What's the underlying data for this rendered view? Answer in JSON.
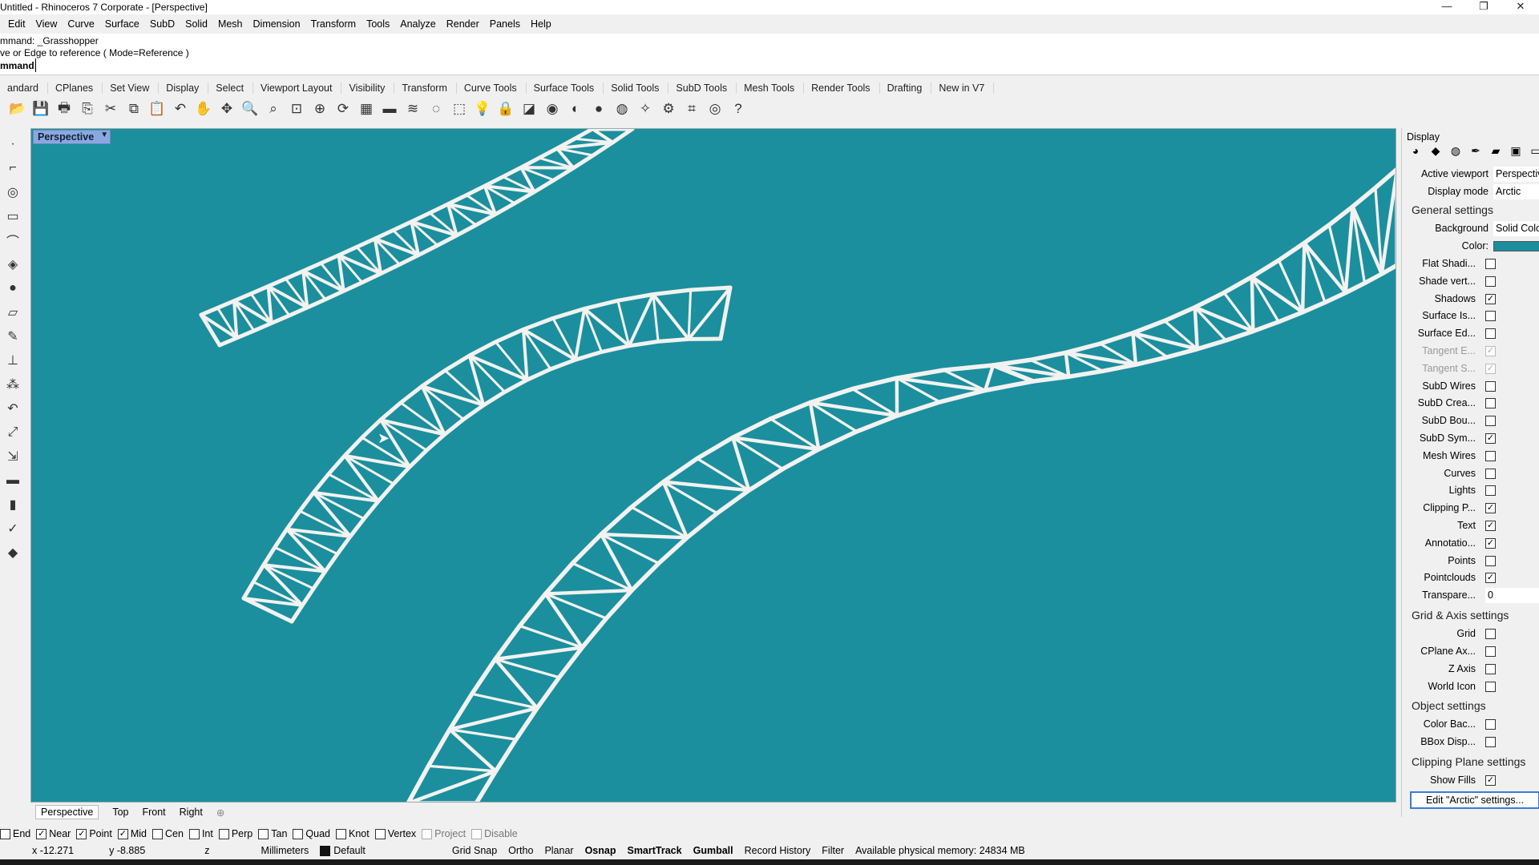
{
  "window": {
    "title": "Untitled - Rhinoceros 7 Corporate - [Perspective]",
    "minimize": "—",
    "maximize": "❐",
    "close": "✕"
  },
  "menu": [
    "Edit",
    "View",
    "Curve",
    "Surface",
    "SubD",
    "Solid",
    "Mesh",
    "Dimension",
    "Transform",
    "Tools",
    "Analyze",
    "Render",
    "Panels",
    "Help"
  ],
  "command": {
    "history1": "mmand: _Grasshopper",
    "history2": "ve or Edge to reference ( Mode=Reference )",
    "prompt": "mmand:",
    "value": ""
  },
  "toolbar_tabs": [
    "andard",
    "CPlanes",
    "Set View",
    "Display",
    "Select",
    "Viewport Layout",
    "Visibility",
    "Transform",
    "Curve Tools",
    "Surface Tools",
    "Solid Tools",
    "SubD Tools",
    "Mesh Tools",
    "Render Tools",
    "Drafting",
    "New in V7"
  ],
  "toolbar_icons": [
    "open-icon",
    "save-icon",
    "print-icon",
    "import-icon",
    "cut-icon",
    "copy-icon",
    "paste-icon",
    "undo-icon",
    "pan-icon",
    "rotate-view-icon",
    "zoom-icon",
    "zoom-window-icon",
    "zoom-extents-icon",
    "zoom-selected-icon",
    "rotate-icon",
    "grid-icon",
    "properties-icon",
    "layer-icon",
    "point-icon",
    "select-icon",
    "light-icon",
    "lock-icon",
    "render-icon",
    "color-icon",
    "material-icon",
    "shaded-icon",
    "rendered-icon",
    "gumball-icon",
    "options-icon",
    "snap-icon",
    "globe-icon",
    "help-icon"
  ],
  "viewport": {
    "name": "Perspective",
    "background": "#1b8f9d"
  },
  "viewport_tabs": [
    "Perspective",
    "Top",
    "Front",
    "Right"
  ],
  "viewport_add": "⊕",
  "osnaps": [
    {
      "label": "End",
      "checked": false,
      "dim": false
    },
    {
      "label": "Near",
      "checked": true,
      "dim": false
    },
    {
      "label": "Point",
      "checked": true,
      "dim": false
    },
    {
      "label": "Mid",
      "checked": true,
      "dim": false
    },
    {
      "label": "Cen",
      "checked": false,
      "dim": false
    },
    {
      "label": "Int",
      "checked": false,
      "dim": false
    },
    {
      "label": "Perp",
      "checked": false,
      "dim": false
    },
    {
      "label": "Tan",
      "checked": false,
      "dim": false
    },
    {
      "label": "Quad",
      "checked": false,
      "dim": false
    },
    {
      "label": "Knot",
      "checked": false,
      "dim": false
    },
    {
      "label": "Vertex",
      "checked": false,
      "dim": false
    },
    {
      "label": "Project",
      "checked": false,
      "dim": true
    },
    {
      "label": "Disable",
      "checked": false,
      "dim": true
    }
  ],
  "status": {
    "x": "x -12.271",
    "y": "y -8.885",
    "z": "z",
    "units": "Millimeters",
    "layer": "Default",
    "grid_snap": "Grid Snap",
    "ortho": "Ortho",
    "planar": "Planar",
    "osnap": "Osnap",
    "smarttrack": "SmartTrack",
    "gumball": "Gumball",
    "record_history": "Record History",
    "filter": "Filter",
    "memory": "Available physical memory: 24834 MB"
  },
  "panel": {
    "title": "Display",
    "active_viewport_label": "Active viewport",
    "active_viewport": "Perspective",
    "display_mode_label": "Display mode",
    "display_mode": "Arctic",
    "general_settings": "General settings",
    "background_label": "Background",
    "background": "Solid Color",
    "color_label": "Color:",
    "color": "#1b8f9d",
    "general_checks": [
      {
        "label": "Flat Shadi...",
        "checked": false,
        "dim": false
      },
      {
        "label": "Shade vert...",
        "checked": false,
        "dim": false
      },
      {
        "label": "Shadows",
        "checked": true,
        "dim": false
      },
      {
        "label": "Surface Is...",
        "checked": false,
        "dim": false
      },
      {
        "label": "Surface Ed...",
        "checked": false,
        "dim": false
      },
      {
        "label": "Tangent E...",
        "checked": true,
        "dim": true
      },
      {
        "label": "Tangent S...",
        "checked": true,
        "dim": true
      },
      {
        "label": "SubD Wires",
        "checked": false,
        "dim": false
      },
      {
        "label": "SubD Crea...",
        "checked": false,
        "dim": false
      },
      {
        "label": "SubD Bou...",
        "checked": false,
        "dim": false
      },
      {
        "label": "SubD Sym...",
        "checked": true,
        "dim": false
      },
      {
        "label": "Mesh Wires",
        "checked": false,
        "dim": false
      },
      {
        "label": "Curves",
        "checked": false,
        "dim": false
      },
      {
        "label": "Lights",
        "checked": false,
        "dim": false
      },
      {
        "label": "Clipping P...",
        "checked": true,
        "dim": false
      },
      {
        "label": "Text",
        "checked": true,
        "dim": false
      },
      {
        "label": "Annotatio...",
        "checked": true,
        "dim": false
      },
      {
        "label": "Points",
        "checked": false,
        "dim": false
      },
      {
        "label": "Pointclouds",
        "checked": true,
        "dim": false
      }
    ],
    "transparency_label": "Transpare...",
    "transparency": "0",
    "grid_section": "Grid & Axis settings",
    "grid_checks": [
      {
        "label": "Grid",
        "checked": false
      },
      {
        "label": "CPlane Ax...",
        "checked": false
      },
      {
        "label": "Z Axis",
        "checked": false
      },
      {
        "label": "World Icon",
        "checked": false
      }
    ],
    "object_section": "Object settings",
    "object_checks": [
      {
        "label": "Color Bac...",
        "checked": false
      },
      {
        "label": "BBox Disp...",
        "checked": false
      }
    ],
    "clipping_section": "Clipping Plane settings",
    "clipping_checks": [
      {
        "label": "Show Fills",
        "checked": true
      }
    ],
    "edit_button": "Edit \"Arctic\" settings..."
  }
}
